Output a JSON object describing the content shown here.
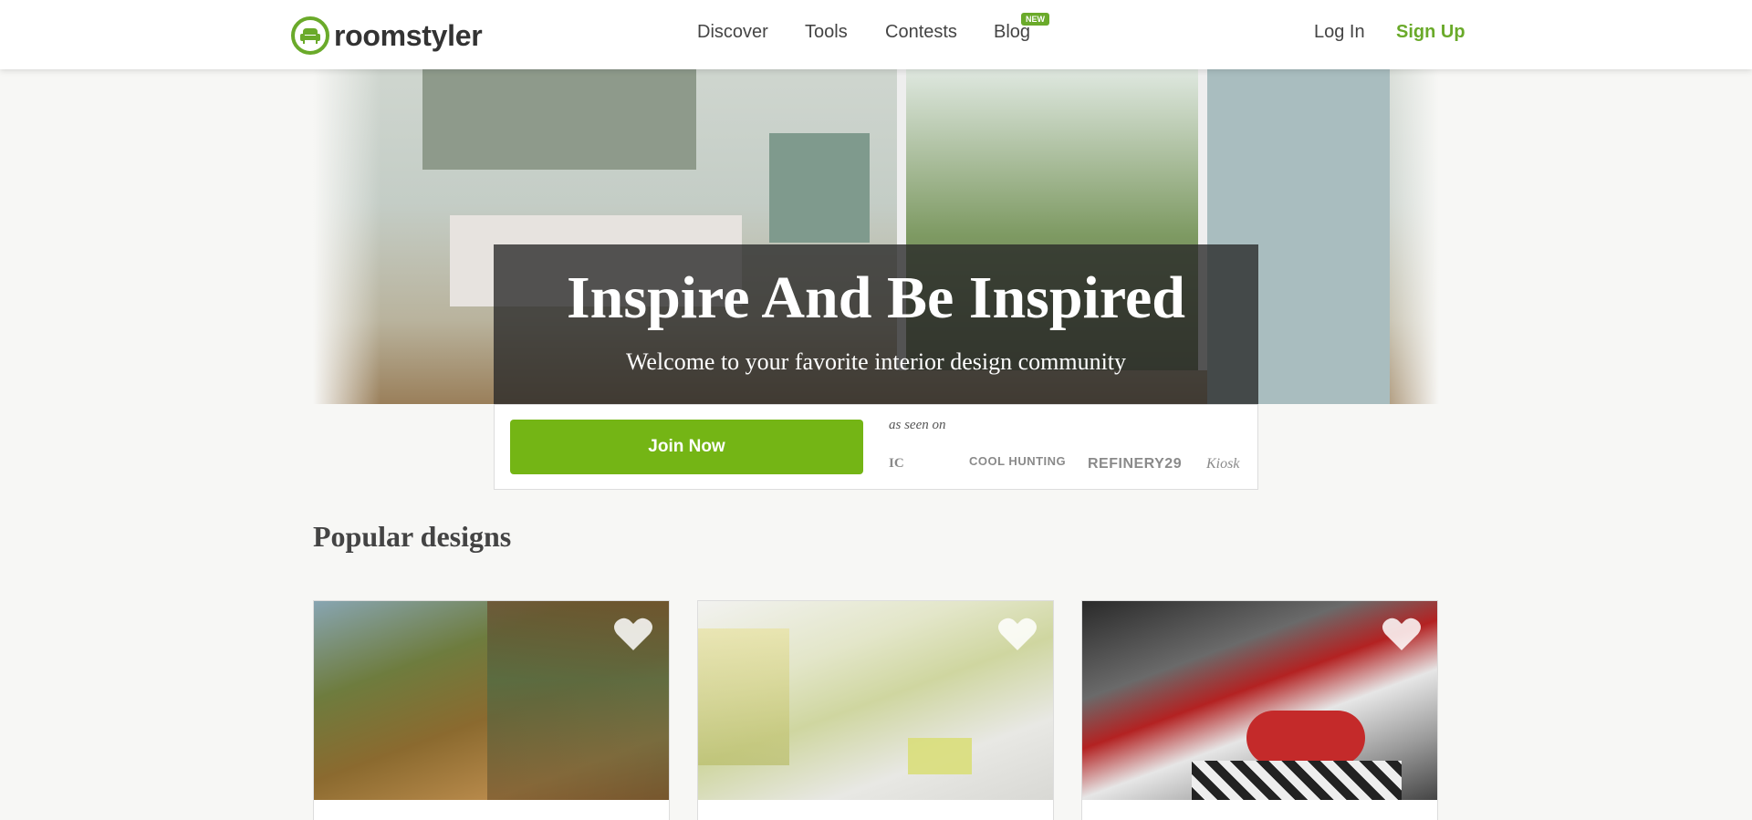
{
  "header": {
    "logo_text": "roomstyler",
    "nav": [
      {
        "label": "Discover"
      },
      {
        "label": "Tools"
      },
      {
        "label": "Contests"
      },
      {
        "label": "Blog"
      }
    ],
    "new_badge": "NEW",
    "login": "Log In",
    "signup": "Sign Up"
  },
  "hero": {
    "title": "Inspire And Be Inspired",
    "subtitle": "Welcome to your favorite interior design community",
    "join_button": "Join Now",
    "as_seen_on": "as seen on",
    "press_logos": [
      "IC",
      "COOL HUNTING",
      "REFINERY29",
      "Kiosk"
    ]
  },
  "popular": {
    "title": "Popular designs",
    "cards": [
      {
        "image": "room-design-1"
      },
      {
        "image": "room-design-2"
      },
      {
        "image": "room-design-3"
      }
    ]
  },
  "colors": {
    "brand_green": "#6aaa2a",
    "button_green": "#74b515"
  }
}
